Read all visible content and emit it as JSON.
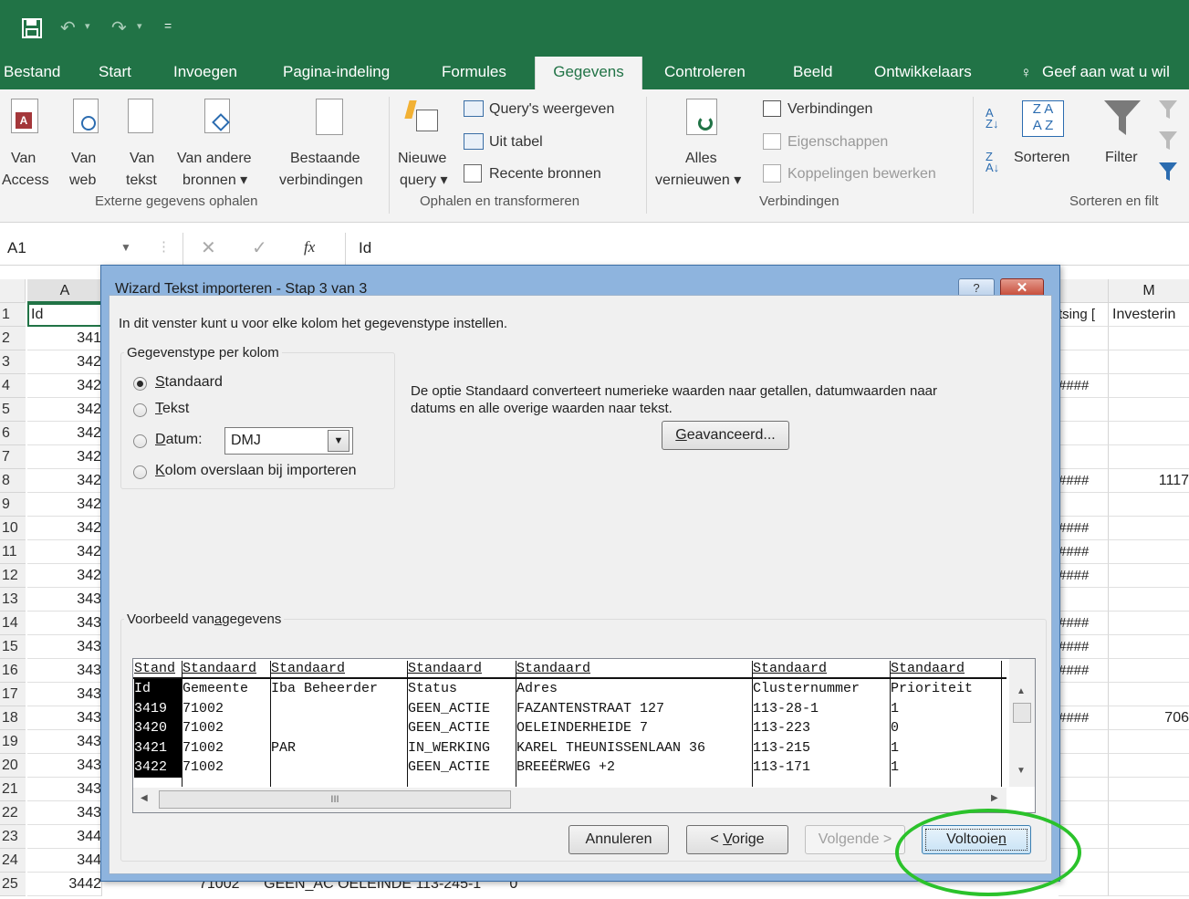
{
  "app": {
    "accent": "#217346",
    "qat": {
      "save": "save-icon",
      "undo": "undo-icon",
      "redo": "redo-icon",
      "customize": "customize-qat-icon"
    }
  },
  "tabs": [
    "Bestand",
    "Start",
    "Invoegen",
    "Pagina-indeling",
    "Formules",
    "Gegevens",
    "Controleren",
    "Beeld",
    "Ontwikkelaars",
    "Geef aan wat u wil"
  ],
  "active_tab": "Gegevens",
  "ribbon": {
    "access": [
      "Van",
      "Access"
    ],
    "web": [
      "Van",
      "web"
    ],
    "text": [
      "Van",
      "tekst"
    ],
    "other": [
      "Van andere",
      "bronnen ▾"
    ],
    "existing": [
      "Bestaande",
      "verbindingen"
    ],
    "group1": "Externe gegevens ophalen",
    "newquery": [
      "Nieuwe",
      "query ▾"
    ],
    "showq": "Query's weergeven",
    "table": "Uit tabel",
    "recent": "Recente bronnen",
    "group2": "Ophalen en transformeren",
    "refresh": [
      "Alles",
      "vernieuwen ▾"
    ],
    "connections": "Verbindingen",
    "props": "Eigenschappen",
    "links": "Koppelingen bewerken",
    "group3": "Verbindingen",
    "sort": "Sorteren",
    "filter": "Filter",
    "group4": "Sorteren en filt"
  },
  "formula": {
    "cellref": "A1",
    "fx": "fx",
    "value": "Id"
  },
  "sheet": {
    "col_a": "A",
    "col_m": "M",
    "rows": [
      "1",
      "2",
      "3",
      "4",
      "5",
      "6",
      "7",
      "8",
      "9",
      "10",
      "11",
      "12",
      "13",
      "14",
      "15",
      "16",
      "17",
      "18",
      "19",
      "20",
      "21",
      "22",
      "23",
      "24",
      "25"
    ],
    "col_a_vals": [
      "Id",
      "341",
      "342",
      "342",
      "342",
      "342",
      "342",
      "342",
      "342",
      "342",
      "342",
      "342",
      "343",
      "343",
      "343",
      "343",
      "343",
      "343",
      "343",
      "343",
      "343",
      "343",
      "344",
      "344",
      "3442"
    ],
    "col_l_vals": [
      "tsing [",
      "",
      "",
      "####",
      "",
      "",
      "",
      "####",
      "",
      "####",
      "####",
      "####",
      "",
      "####",
      "####",
      "####",
      "",
      "####",
      "",
      "",
      "",
      "",
      "",
      "",
      ""
    ],
    "col_m_vals": [
      "Investerin",
      "",
      "",
      "",
      "",
      "",
      "",
      "1117",
      "",
      "",
      "",
      "",
      "",
      "",
      "",
      "",
      "",
      "706",
      "",
      "",
      "",
      "",
      "",
      "",
      ""
    ],
    "row25_partial": "71002      GEEN_AC OELEINDE 113-245-1       0"
  },
  "dialog": {
    "title": "Wizard Tekst importeren - Stap 3 van 3",
    "help": "?",
    "intro": "In dit venster kunt u voor elke kolom het gegevenstype instellen.",
    "group_label": "Gegevenstype per kolom",
    "options": [
      "Standaard",
      "Tekst",
      "Datum:",
      "Kolom overslaan bij importeren"
    ],
    "selected": "Standaard",
    "date_format": "DMJ",
    "info": [
      "De optie Standaard converteert numerieke waarden naar getallen, datumwaarden naar",
      "datums en alle overige waarden naar tekst."
    ],
    "advanced": "Geavanceerd...",
    "preview_label": "Voorbeeld van gegevens",
    "preview_types": [
      "Stand",
      "Standaard",
      "Standaard",
      "Standaard",
      "Standaard",
      "Standaard",
      "Standaard"
    ],
    "preview_rows": [
      [
        "Id",
        "Gemeente",
        "Iba Beheerder",
        "Status",
        "Adres",
        "Clusternummer",
        "Prioriteit"
      ],
      [
        "3419",
        "71002",
        "",
        "GEEN_ACTIE",
        "FAZANTENSTRAAT 127",
        "113-28-1",
        "1"
      ],
      [
        "3420",
        "71002",
        "",
        "GEEN_ACTIE",
        "OELEINDERHEIDE 7",
        "113-223",
        "0"
      ],
      [
        "3421",
        "71002",
        "PAR",
        "IN_WERKING",
        "KAREL THEUNISSENLAAN 36",
        "113-215",
        "1"
      ],
      [
        "3422",
        "71002",
        "",
        "GEEN_ACTIE",
        "BREEËRWEG +2",
        "113-171",
        "1"
      ]
    ],
    "scroll_mid": "III",
    "buttons": {
      "cancel": "Annuleren",
      "back": "< Vorige",
      "next": "Volgende >",
      "finish": "Voltooien"
    }
  },
  "highlight_color": "#2bc22b"
}
